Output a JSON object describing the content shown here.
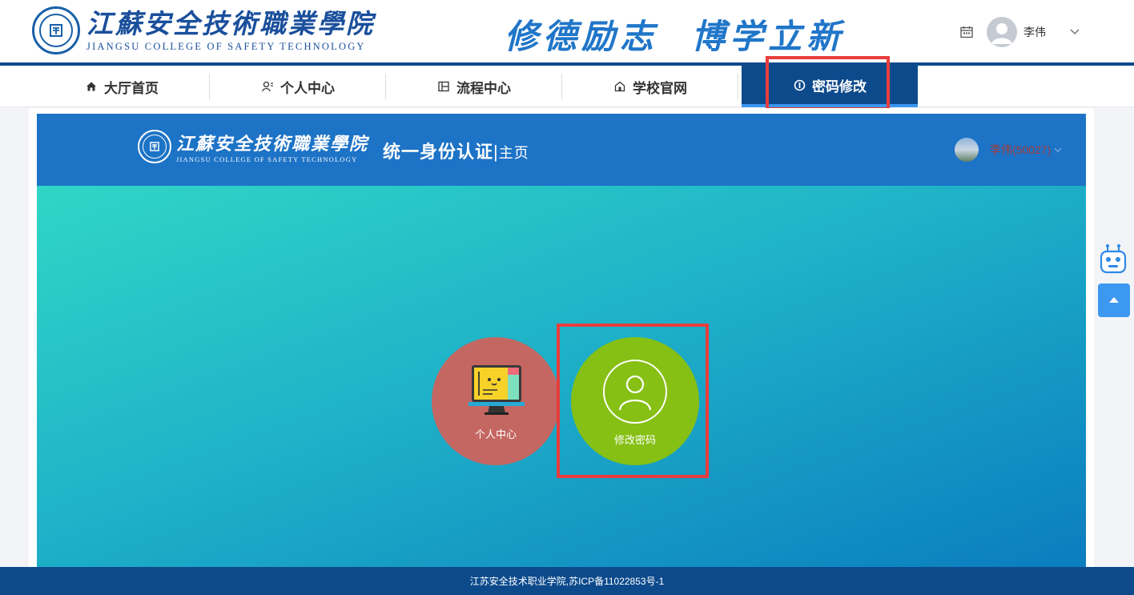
{
  "header": {
    "logo_cn": "江蘇安全技術職業學院",
    "logo_en": "JIANGSU COLLEGE OF SAFETY TECHNOLOGY",
    "slogan": "修德励志  博学立新",
    "user_name": "李伟"
  },
  "nav": {
    "items": [
      {
        "label": "大厅首页",
        "icon": "home-icon"
      },
      {
        "label": "个人中心",
        "icon": "person-icon"
      },
      {
        "label": "流程中心",
        "icon": "process-icon"
      },
      {
        "label": "学校官网",
        "icon": "school-icon"
      },
      {
        "label": "密码修改",
        "icon": "info-icon",
        "active": true
      }
    ]
  },
  "sso": {
    "logo_cn": "江蘇安全技術職業學院",
    "logo_en": "JIANGSU COLLEGE OF SAFETY TECHNOLOGY",
    "title": "统一身份认证",
    "subtitle": "主页",
    "user": "李伟(50027)"
  },
  "tiles": [
    {
      "label": "个人中心",
      "color": "#c46762",
      "icon": "computer-icon"
    },
    {
      "label": "修改密码",
      "color": "#86c014",
      "icon": "user-icon"
    }
  ],
  "footer": {
    "text": "江苏安全技术职业学院,苏ICP备11022853号-1"
  },
  "colors": {
    "primary": "#0c4a8c",
    "accent": "#2076c9",
    "highlight": "#e83d3d"
  }
}
